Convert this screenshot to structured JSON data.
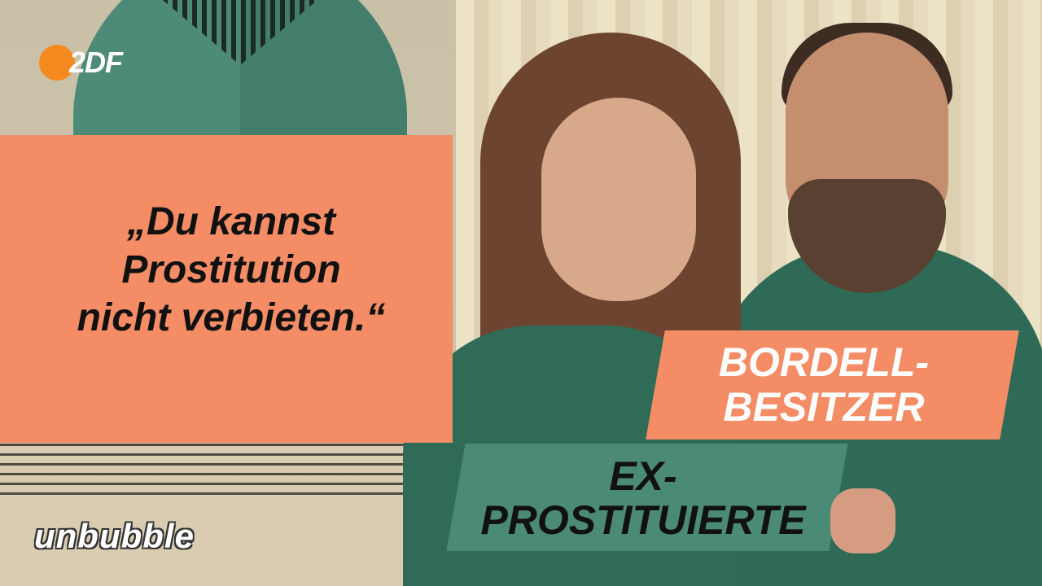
{
  "brand": {
    "broadcaster_logo": "2DF",
    "show_logo": "unbubble"
  },
  "quote": {
    "line1": "„Du kannst",
    "line2": "Prostitution",
    "line3": "nicht verbieten.“"
  },
  "labels": {
    "man_line1": "BORDELL-",
    "man_line2": "BESITZER",
    "woman_line1": "EX-",
    "woman_line2": "PROSTITUIERTE"
  },
  "colors": {
    "accent_orange": "#f48c66",
    "accent_green": "#4b8a77",
    "zdf_orange": "#f48a1f"
  }
}
